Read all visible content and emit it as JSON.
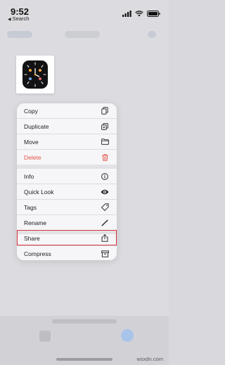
{
  "status_bar": {
    "time": "9:52",
    "back_label": "Search",
    "icons": [
      "signal-icon",
      "wifi-icon",
      "battery-icon"
    ]
  },
  "menu": {
    "items": [
      {
        "label": "Copy",
        "icon": "copy-icon"
      },
      {
        "label": "Duplicate",
        "icon": "duplicate-icon"
      },
      {
        "label": "Move",
        "icon": "folder-icon"
      },
      {
        "label": "Delete",
        "icon": "trash-icon",
        "destructive": true
      },
      {
        "label": "Info",
        "icon": "info-icon"
      },
      {
        "label": "Quick Look",
        "icon": "eye-icon"
      },
      {
        "label": "Tags",
        "icon": "tag-icon"
      },
      {
        "label": "Rename",
        "icon": "pencil-icon"
      },
      {
        "label": "Share",
        "icon": "share-icon",
        "highlighted": true
      },
      {
        "label": "Compress",
        "icon": "archive-icon"
      }
    ]
  },
  "colors": {
    "destructive": "#e5534b",
    "highlight_border": "#d8323a",
    "accent": "#1a84ff"
  },
  "watermark": "wsxdn.com"
}
